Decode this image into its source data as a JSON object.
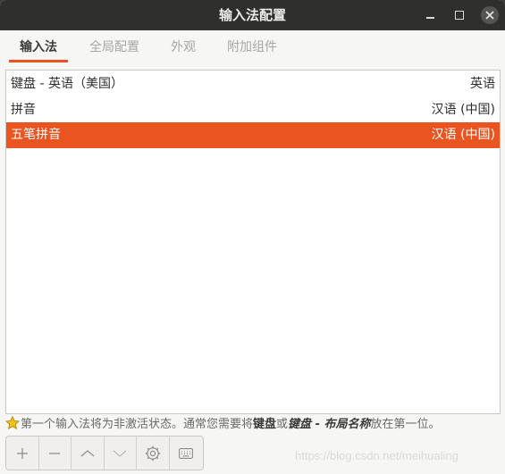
{
  "window": {
    "title": "输入法配置"
  },
  "tabs": [
    {
      "label": "输入法",
      "active": true
    },
    {
      "label": "全局配置",
      "active": false
    },
    {
      "label": "外观",
      "active": false
    },
    {
      "label": "附加组件",
      "active": false
    }
  ],
  "input_methods": [
    {
      "name": "键盘 - 英语（美国）",
      "language": "英语",
      "selected": false
    },
    {
      "name": "拼音",
      "language": "汉语 (中国)",
      "selected": false
    },
    {
      "name": "五笔拼音",
      "language": "汉语 (中国)",
      "selected": true
    }
  ],
  "hint": {
    "icon": "star-icon",
    "part1": "第一个输入法将为非激活状态。通常您需要将",
    "bold1": "键盘",
    "part2": "或",
    "bold2": "键盘 - 布局名称",
    "part3": "放在第一位。"
  },
  "toolbar": {
    "add_icon": "plus-icon",
    "remove_icon": "minus-icon",
    "up_icon": "chevron-up-icon",
    "down_icon": "chevron-down-icon",
    "configure_icon": "gear-icon",
    "keyboard_icon": "keyboard-icon"
  },
  "watermark": "https://blog.csdn.net/meihualing",
  "colors": {
    "accent": "#e95420",
    "titlebar": "#2f2f2d",
    "background": "#f6f6f5"
  }
}
